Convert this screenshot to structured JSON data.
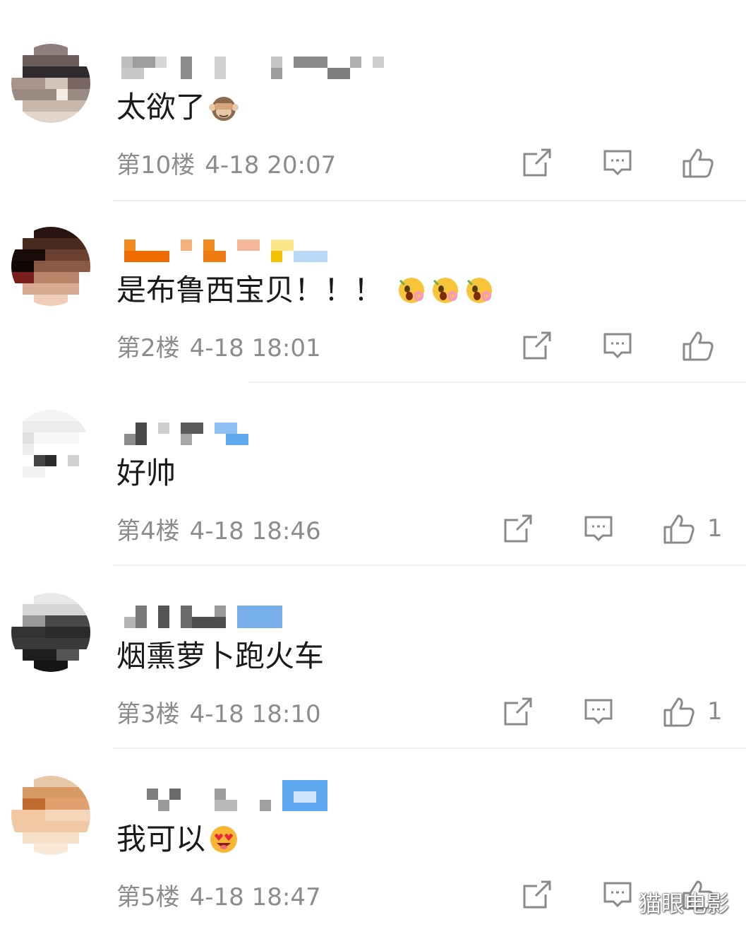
{
  "comments": [
    {
      "text": "太欲了",
      "emoji": [
        "see-no-evil-monkey-icon"
      ],
      "floor": "第10楼",
      "time": "4-18 20:07",
      "likes": ""
    },
    {
      "text": "是布鲁西宝贝！！！",
      "emoji": [
        "flower-face-icon",
        "flower-face-icon",
        "flower-face-icon"
      ],
      "floor": "第2楼",
      "time": "4-18 18:01",
      "likes": ""
    },
    {
      "text": "好帅",
      "emoji": [],
      "floor": "第4楼",
      "time": "4-18 18:46",
      "likes": "1"
    },
    {
      "text": "烟熏萝卜跑火车",
      "emoji": [],
      "floor": "第3楼",
      "time": "4-18 18:10",
      "likes": "1"
    },
    {
      "text": "我可以",
      "emoji": [
        "heart-eyes-face-icon"
      ],
      "floor": "第5楼",
      "time": "4-18 18:47",
      "likes": ""
    }
  ],
  "watermark": "猫眼电影",
  "colors": {
    "meta": "#8c8c8c",
    "text": "#1a1a1a",
    "divider": "#eeeeee",
    "icon": "#8a8a8a"
  }
}
